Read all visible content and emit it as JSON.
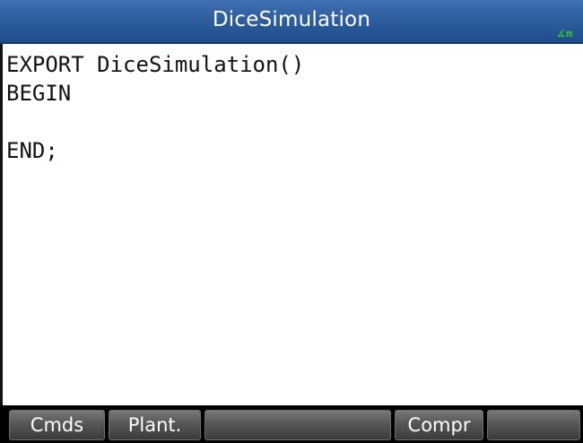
{
  "header": {
    "title": "DiceSimulation",
    "angle_mode_indicator": "∡π",
    "colors": {
      "title_bar": "#2f5e9f",
      "angle_indicator": "#34c134"
    }
  },
  "editor": {
    "lines": [
      "EXPORT DiceSimulation()",
      "BEGIN",
      "",
      "END;"
    ]
  },
  "menu": {
    "softkeys": [
      "Cmds",
      "Plant.",
      "",
      "Compr",
      ""
    ]
  }
}
